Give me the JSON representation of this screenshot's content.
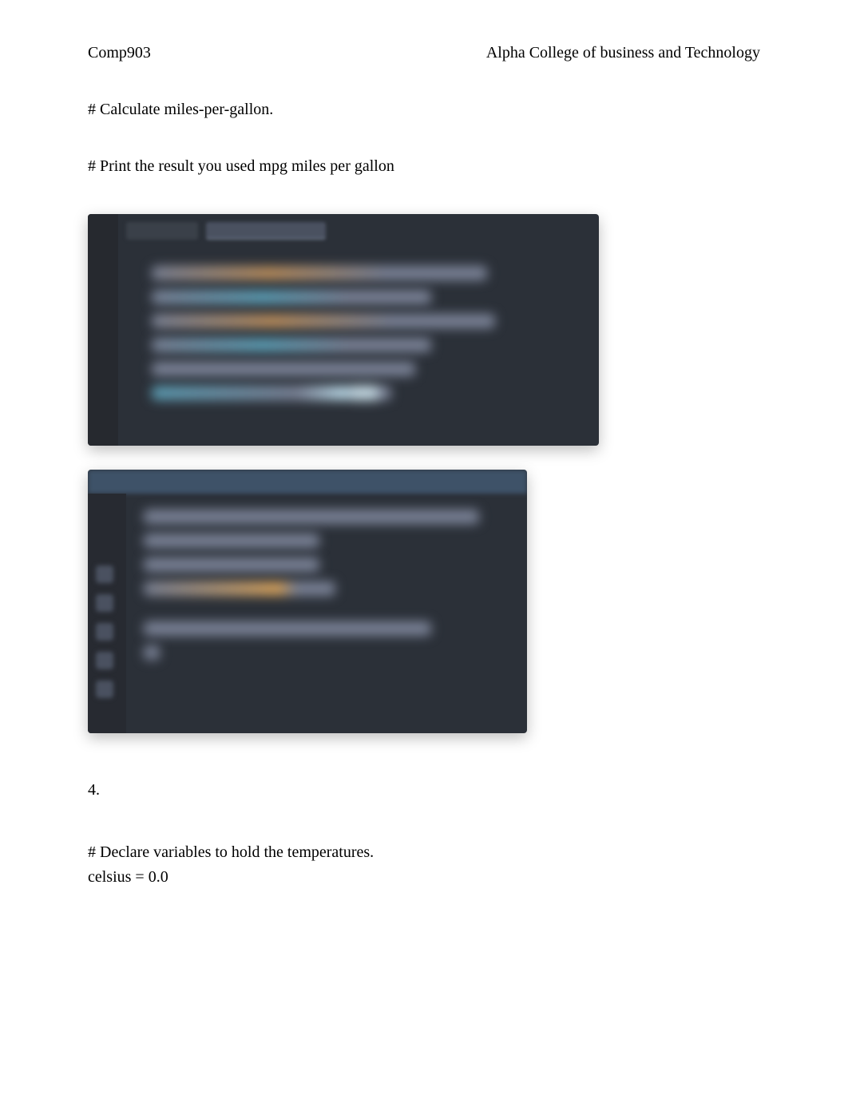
{
  "header": {
    "course": "Comp903",
    "institution": "Alpha College of business and Technology"
  },
  "comments": {
    "calc_mpg": "# Calculate miles-per-gallon.",
    "print_result": "# Print the result you used mpg miles per gallon",
    "declare_vars": "# Declare variables to hold the temperatures.",
    "celsius_line": "celsius = 0.0"
  },
  "question": {
    "number": "4."
  }
}
